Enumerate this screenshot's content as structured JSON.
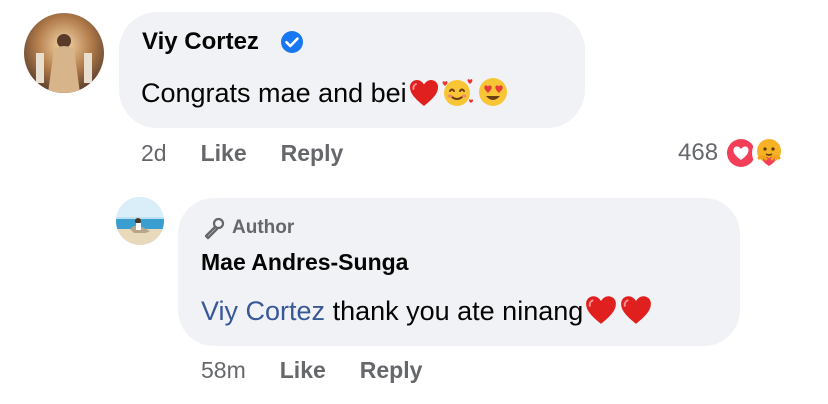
{
  "comment": {
    "author": "Viy Cortez",
    "text": "Congrats mae and bei",
    "emojis": [
      "red-heart",
      "smiling-face-with-hearts",
      "heart-eyes"
    ],
    "time": "2d",
    "like_label": "Like",
    "reply_label": "Reply",
    "reaction_count": "468",
    "reaction_icons": [
      "love-reaction",
      "care-reaction"
    ]
  },
  "reply": {
    "badge_label": "Author",
    "author": "Mae Andres-Sunga",
    "mention": "Viy Cortez",
    "text": "thank you ate ninang",
    "emojis": [
      "red-heart",
      "red-heart"
    ],
    "time": "58m",
    "like_label": "Like",
    "reply_label": "Reply"
  },
  "colors": {
    "bubble": "#f0f2f5",
    "verified": "#1877f2",
    "mention": "#385898",
    "secondary_text": "#65676b",
    "love": "#f33e58",
    "care": "#f7b125"
  }
}
